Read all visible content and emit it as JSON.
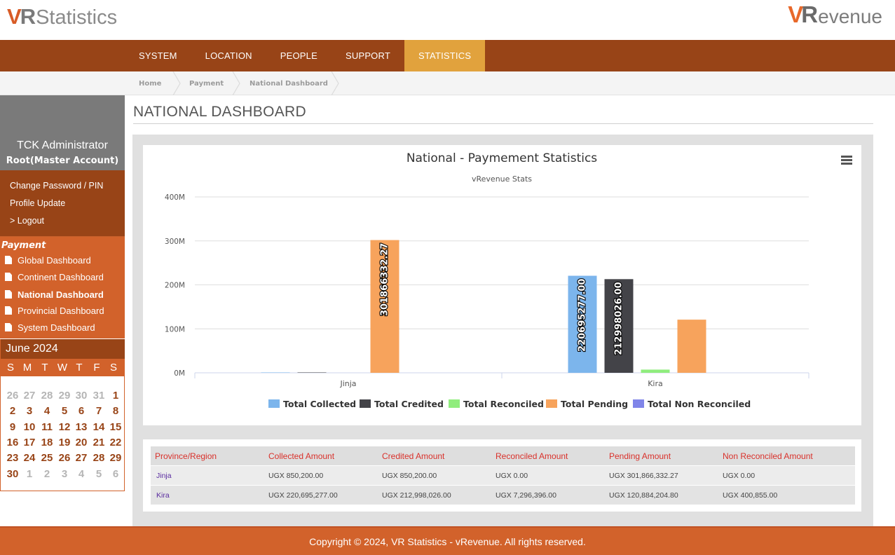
{
  "logo_left": {
    "v": "V",
    "r": "R",
    "rest": "Statistics"
  },
  "logo_right": {
    "v": "V",
    "r": "R",
    "rest": "evenue"
  },
  "nav": [
    "SYSTEM",
    "LOCATION",
    "PEOPLE",
    "SUPPORT",
    "STATISTICS"
  ],
  "nav_active": "STATISTICS",
  "breadcrumb": [
    "Home",
    "Payment",
    "National Dashboard"
  ],
  "sidebar": {
    "user_name": "TCK Administrator",
    "user_role": "Root(Master Account)",
    "links": [
      "Change Password / PIN",
      "Profile Update",
      "> Logout"
    ],
    "menu_title": "Payment",
    "menu": [
      "Global Dashboard",
      "Continent Dashboard",
      "National Dashboard",
      "Provincial Dashboard",
      "System Dashboard"
    ],
    "menu_active": "National Dashboard"
  },
  "calendar": {
    "title": "June 2024",
    "dows": [
      "S",
      "M",
      "T",
      "W",
      "T",
      "F",
      "S"
    ],
    "weeks": [
      [
        [
          "26",
          true
        ],
        [
          "27",
          true
        ],
        [
          "28",
          true
        ],
        [
          "29",
          true
        ],
        [
          "30",
          true
        ],
        [
          "31",
          true
        ],
        [
          "1",
          false
        ]
      ],
      [
        [
          "2",
          false
        ],
        [
          "3",
          false
        ],
        [
          "4",
          false
        ],
        [
          "5",
          false
        ],
        [
          "6",
          false
        ],
        [
          "7",
          false
        ],
        [
          "8",
          false
        ]
      ],
      [
        [
          "9",
          false
        ],
        [
          "10",
          false
        ],
        [
          "11",
          false
        ],
        [
          "12",
          false
        ],
        [
          "13",
          false
        ],
        [
          "14",
          false
        ],
        [
          "15",
          false
        ]
      ],
      [
        [
          "16",
          false
        ],
        [
          "17",
          false
        ],
        [
          "18",
          false
        ],
        [
          "19",
          false
        ],
        [
          "20",
          false
        ],
        [
          "21",
          false
        ],
        [
          "22",
          false
        ]
      ],
      [
        [
          "23",
          false
        ],
        [
          "24",
          false
        ],
        [
          "25",
          false
        ],
        [
          "26",
          false
        ],
        [
          "27",
          false
        ],
        [
          "28",
          false
        ],
        [
          "29",
          false
        ]
      ],
      [
        [
          "30",
          false
        ],
        [
          "1",
          true
        ],
        [
          "2",
          true
        ],
        [
          "3",
          true
        ],
        [
          "4",
          true
        ],
        [
          "5",
          true
        ],
        [
          "6",
          true
        ]
      ]
    ]
  },
  "page_title": "NATIONAL DASHBOARD",
  "chart_data": {
    "type": "bar",
    "title": "National - Paymement Statistics",
    "subtitle": "vRevenue Stats",
    "categories": [
      "Jinja",
      "Kira"
    ],
    "ylim": [
      0,
      400000000
    ],
    "yticks": [
      0,
      100000000,
      200000000,
      300000000,
      400000000
    ],
    "ytick_labels": [
      "0M",
      "100M",
      "200M",
      "300M",
      "400M"
    ],
    "grid": true,
    "legend_position": "bottom",
    "series": [
      {
        "name": "Total Collected",
        "color": "#7cb5ec",
        "values": [
          850200.0,
          220695277.0
        ],
        "labels": [
          "",
          "220695277.00"
        ]
      },
      {
        "name": "Total Credited",
        "color": "#434348",
        "values": [
          850200.0,
          212998026.0
        ],
        "labels": [
          "",
          "212998026.00"
        ]
      },
      {
        "name": "Total Reconciled",
        "color": "#90ed7d",
        "values": [
          0.0,
          7296396.0
        ],
        "labels": [
          "",
          ""
        ]
      },
      {
        "name": "Total Pending",
        "color": "#f7a35c",
        "values": [
          301866332.27,
          120884204.8
        ],
        "labels": [
          "301866332.27",
          ""
        ]
      },
      {
        "name": "Total Non Reconciled",
        "color": "#8085e9",
        "values": [
          0.0,
          400855.0
        ],
        "labels": [
          "",
          ""
        ]
      }
    ]
  },
  "table": {
    "headers": [
      "Province/Region",
      "Collected Amount",
      "Credited Amount",
      "Reconciled Amount",
      "Pending Amount",
      "Non Reconciled Amount"
    ],
    "rows": [
      [
        "Jinja",
        "UGX 850,200.00",
        "UGX 850,200.00",
        "UGX 0.00",
        "UGX 301,866,332.27",
        "UGX 0.00"
      ],
      [
        "Kira",
        "UGX 220,695,277.00",
        "UGX 212,998,026.00",
        "UGX 7,296,396.00",
        "UGX 120,884,204.80",
        "UGX 400,855.00"
      ]
    ]
  },
  "footer": "Copyright © 2024, VR Statistics - vRevenue. All rights reserved."
}
